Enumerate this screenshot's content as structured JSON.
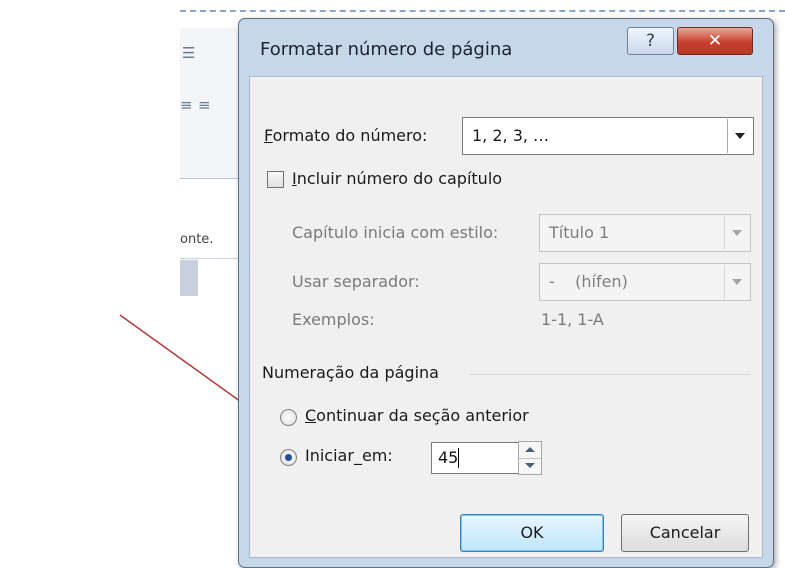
{
  "background": {
    "partial_text": "onte."
  },
  "dialog": {
    "title": "Formatar número de página",
    "help_label": "?",
    "close_label": "✕",
    "number_format": {
      "label_accel": "F",
      "label_rest": "ormato do número:",
      "value": "1, 2, 3, …"
    },
    "include_chapter": {
      "label_accel": "I",
      "label_rest": "ncluir número do capítulo",
      "checked": false
    },
    "chapter_style": {
      "label": "Capítulo inicia com estilo:",
      "value": "Título 1"
    },
    "separator": {
      "label": "Usar separador:",
      "value": "-    (hífen)"
    },
    "examples": {
      "label": "Exemplos:",
      "value": "1-1, 1-A"
    },
    "page_numbering": {
      "group_label": "Numeração da página",
      "continue": {
        "label_accel": "C",
        "label_rest": "ontinuar da seção anterior",
        "selected": false
      },
      "start_at": {
        "label_pre": "Iniciar",
        "label_accel": "_",
        "label_post": "em:",
        "selected": true,
        "value": "45"
      }
    },
    "ok_label": "OK",
    "cancel_label": "Cancelar"
  },
  "colors": {
    "annotation_arrow": "#b03a3a",
    "dialog_frame": "#c6d7ea",
    "close_button": "#c8402c"
  }
}
